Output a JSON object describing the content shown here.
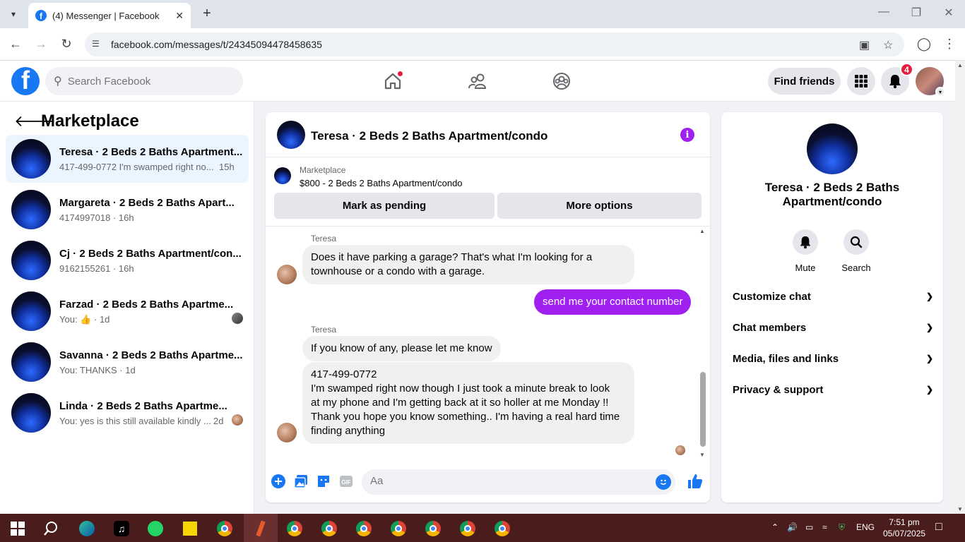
{
  "browser": {
    "tab_title": "(4) Messenger | Facebook",
    "url": "facebook.com/messages/t/24345094478458635"
  },
  "fb_header": {
    "search_placeholder": "Search Facebook",
    "find_friends": "Find friends",
    "notification_count": "4"
  },
  "left": {
    "title": "Marketplace",
    "conversations": [
      {
        "name": "Teresa · 2 Beds 2 Baths Apartment...",
        "snippet": "417-499-0772 I'm swamped right no...",
        "time": "15h"
      },
      {
        "name": "Margareta · 2 Beds 2 Baths Apart...",
        "snippet": "4174997018 · 16h",
        "time": ""
      },
      {
        "name": "Cj · 2 Beds 2 Baths Apartment/con...",
        "snippet": "9162155261 · 16h",
        "time": ""
      },
      {
        "name": "Farzad · 2 Beds 2 Baths Apartme...",
        "snippet_prefix": "You:",
        "snippet": "· 1d",
        "time": ""
      },
      {
        "name": "Savanna · 2 Beds 2 Baths Apartme...",
        "snippet": "You: THANKS · 1d",
        "time": ""
      },
      {
        "name": "Linda · 2 Beds 2 Baths Apartme...",
        "snippet": "You: yes is this still available kindly ...",
        "time": "2d"
      }
    ]
  },
  "chat": {
    "title": "Teresa · 2 Beds 2 Baths Apartment/condo",
    "marketplace_label": "Marketplace",
    "listing": "$800 - 2 Beds 2 Baths Apartment/condo",
    "mark_pending": "Mark as pending",
    "more_options": "More options",
    "messages": [
      {
        "sender": "Teresa",
        "line1": "Does it have parking a garage? That's what I'm looking for a",
        "line2": "townhouse or a condo with a garage."
      },
      {
        "me": "send me your contact number"
      },
      {
        "sender": "Teresa",
        "text": "If you know of any, please let me know"
      },
      {
        "lines": [
          "417-499-0772",
          "I'm swamped right now though I just took a minute break to look",
          "at my phone and I'm getting back at it so holler at me Monday !!",
          "Thank you hope you know something.. I'm having a real hard time",
          "finding anything"
        ]
      }
    ],
    "composer_placeholder": "Aa"
  },
  "right": {
    "name": "Teresa · 2 Beds 2 Baths Apartment/condo",
    "mute": "Mute",
    "search": "Search",
    "sections": [
      "Customize chat",
      "Chat members",
      "Media, files and links",
      "Privacy & support"
    ]
  },
  "taskbar": {
    "lang": "ENG",
    "time": "7:51 pm",
    "date": "05/07/2025"
  },
  "colors": {
    "fb_blue": "#1877f2",
    "messenger_purple": "#a020f0",
    "active_row": "#ebf5ff"
  }
}
